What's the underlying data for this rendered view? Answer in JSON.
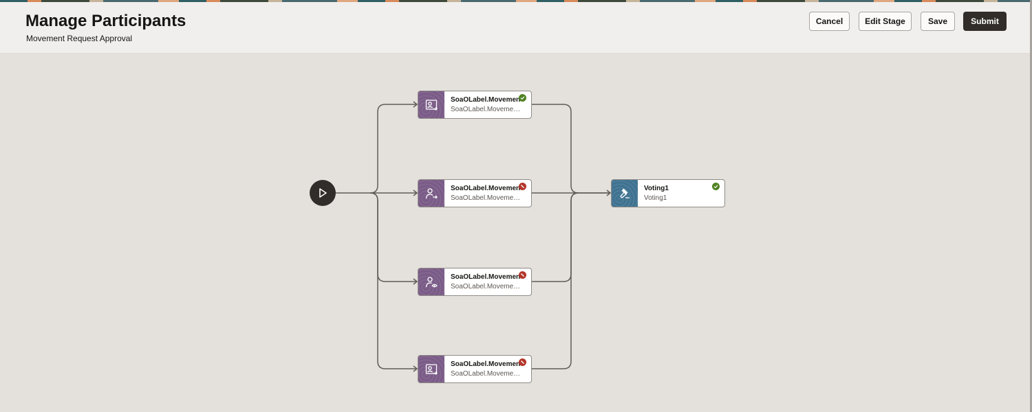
{
  "header": {
    "title": "Manage Participants",
    "subtitle": "Movement Request Approval"
  },
  "actions": {
    "cancel": "Cancel",
    "edit_stage": "Edit Stage",
    "save": "Save",
    "submit": "Submit"
  },
  "colors": {
    "participant_tile": "#7a5b87",
    "voting_tile": "#3f7290",
    "status_ok": "#508223",
    "status_error": "#b3362b"
  },
  "nodes": [
    {
      "title": "SoaOLabel.Movement",
      "subtitle": "SoaOLabel.MovementRequest",
      "icon": "user-assign-icon",
      "status": "ok"
    },
    {
      "title": "SoaOLabel.Movement",
      "subtitle": "SoaOLabel.MovementRequest",
      "icon": "user-forward-icon",
      "status": "error"
    },
    {
      "title": "SoaOLabel.Movement",
      "subtitle": "SoaOLabel.MovementRequest",
      "icon": "user-view-icon",
      "status": "error"
    },
    {
      "title": "SoaOLabel.Movement",
      "subtitle": "SoaOLabel.MovementRequest",
      "icon": "user-assign-icon",
      "status": "error"
    }
  ],
  "voting": {
    "title": "Voting1",
    "subtitle": "Voting1",
    "icon": "gavel-icon",
    "status": "ok"
  }
}
